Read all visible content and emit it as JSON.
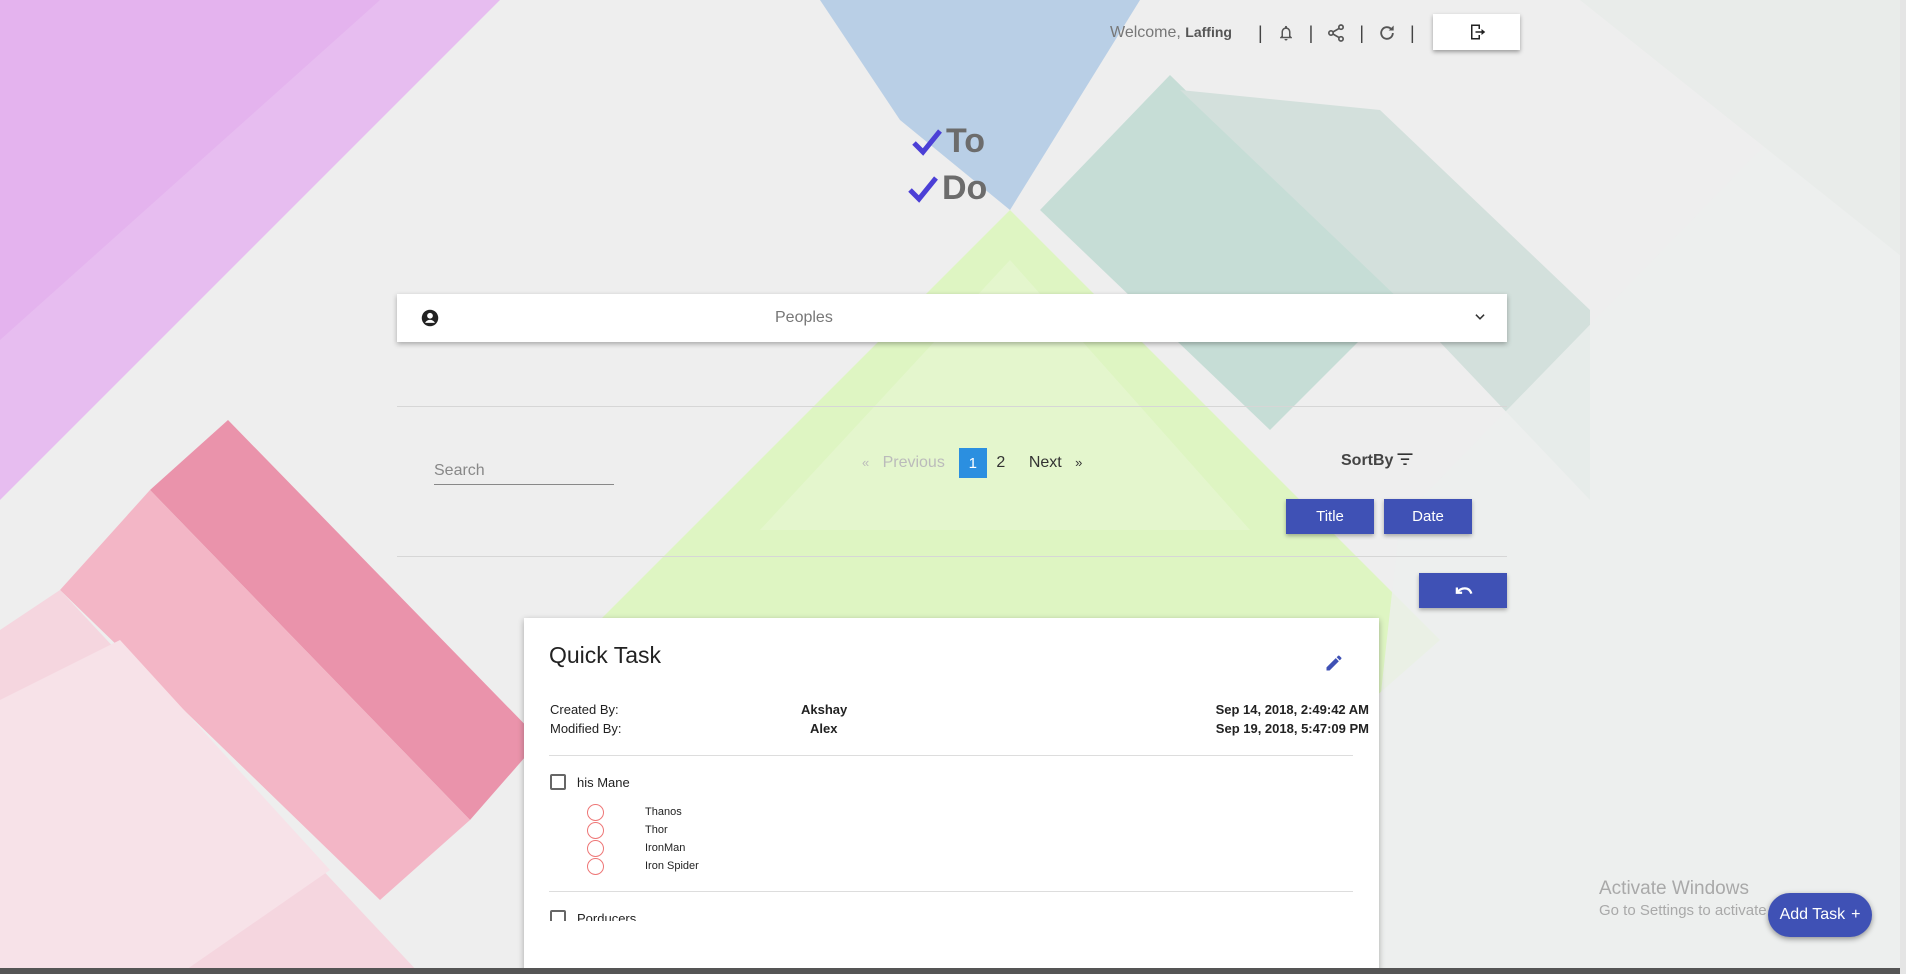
{
  "header": {
    "welcome_text": "Welcome,",
    "username": "Laffing",
    "icons": [
      "bell-icon",
      "share-icon",
      "refresh-icon",
      "logout-icon"
    ]
  },
  "logo": {
    "line1": "To",
    "line2": "Do",
    "accent": "#4b3fd6"
  },
  "peoples": {
    "label": "Peoples"
  },
  "toolbar": {
    "search_placeholder": "Search",
    "prev_label": "Previous",
    "next_label": "Next",
    "prev_symbol": "«",
    "next_symbol": "»",
    "pages": [
      "1",
      "2"
    ],
    "active_page": "1",
    "sort_label": "SortBy",
    "sort_title": "Title",
    "sort_date": "Date"
  },
  "card": {
    "title": "Quick Task",
    "created_by_label": "Created By:",
    "created_by": "Akshay",
    "created_at": "Sep 14, 2018, 2:49:42 AM",
    "modified_by_label": "Modified By:",
    "modified_by": "Alex",
    "modified_at": "Sep 19, 2018, 5:47:09 PM",
    "items": [
      {
        "label": "his Mane",
        "options": [
          "Thanos",
          "Thor",
          "IronMan",
          "Iron Spider"
        ]
      },
      {
        "label": "Porducers",
        "options": []
      }
    ]
  },
  "watermark": {
    "line1": "Activate Windows",
    "line2": "Go to Settings to activate Windows."
  },
  "fab": {
    "label": "Add Task",
    "symbol": "+"
  },
  "colors": {
    "primary": "#3f51b5",
    "active_page": "#2b8fe0"
  }
}
